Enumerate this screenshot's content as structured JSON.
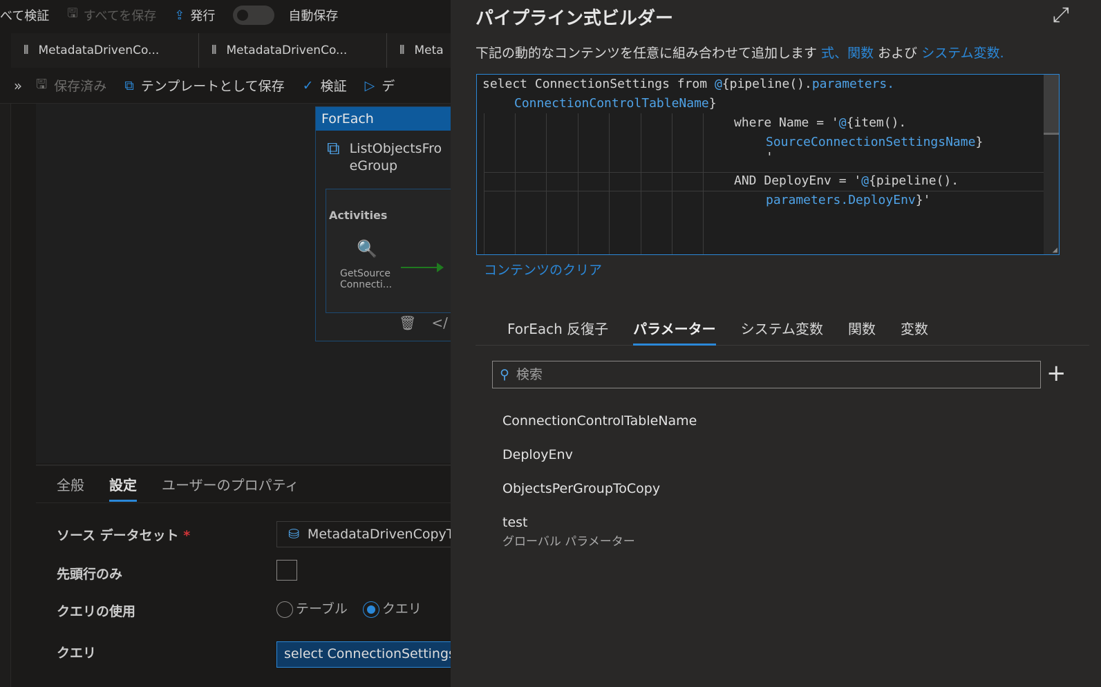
{
  "topbar": {
    "validate_all": "べて検証",
    "save_all": "すべてを保存",
    "publish": "発行",
    "autosave": "自動保存"
  },
  "tabs": [
    {
      "label": "MetadataDrivenCo..."
    },
    {
      "label": "MetadataDrivenCo..."
    },
    {
      "label": "Meta"
    }
  ],
  "toolbar": {
    "saved": "保存済み",
    "save_template": "テンプレートとして保存",
    "validate": "検証",
    "debug": "デ"
  },
  "foreach": {
    "header": "ForEach",
    "activity_name": "ListObjectsFro\neGroup",
    "activities_label": "Activities",
    "getsource": "GetSource\nConnecti..."
  },
  "props": {
    "tabs": [
      "全般",
      "設定",
      "ユーザーのプロパティ"
    ],
    "selected_tab": "設定",
    "source_dataset_label": "ソース データセット",
    "required_mark": "*",
    "source_dataset_value": "MetadataDrivenCopyTa",
    "first_row_label": "先頭行のみ",
    "use_query_label": "クエリの使用",
    "radio_table": "テーブル",
    "radio_query": "クエリ",
    "query_label": "クエリ",
    "query_value": "select ConnectionSettings f"
  },
  "builder": {
    "title": "パイプライン式ビルダー",
    "description_prefix": "下記の動的なコンテンツを任意に組み合わせて追加します ",
    "link_expr": "式",
    "sep": "、",
    "link_func": "関数",
    "and": " および ",
    "link_sysvar": "システム変数.",
    "clear": "コンテンツのクリア",
    "search_placeholder": "検索",
    "editor": {
      "l1a": "select ConnectionSettings from ",
      "l1b": "@",
      "l1c": "{pipeline().",
      "l1d": "parameters.",
      "l2a": "ConnectionControlTableName",
      "l2b": "}",
      "l3a": "where Name = '",
      "l3b": "@",
      "l3c": "{item().",
      "l4a": "SourceConnectionSettingsName",
      "l4b": "}",
      "l5": "'",
      "l6a": "AND",
      "l6b": " DeployEnv = '",
      "l6c": "@",
      "l6d": "{pipeline().",
      "l7a": "parameters.DeployEnv",
      "l7b": "}'"
    },
    "tabs": [
      "ForEach 反復子",
      "パラメーター",
      "システム変数",
      "関数",
      "変数"
    ],
    "selected_tab": "パラメーター",
    "parameters": [
      {
        "name": "ConnectionControlTableName",
        "sub": ""
      },
      {
        "name": "DeployEnv",
        "sub": ""
      },
      {
        "name": "ObjectsPerGroupToCopy",
        "sub": ""
      },
      {
        "name": "test",
        "sub": "グローバル パラメーター"
      }
    ]
  },
  "colors": {
    "accent": "#2b88d8",
    "panel_bg": "#292827",
    "editor_bg": "#1e1e1e"
  }
}
